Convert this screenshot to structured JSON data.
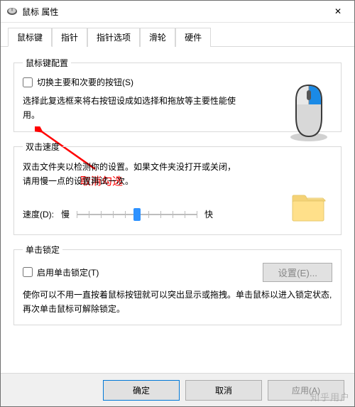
{
  "window": {
    "title": "鼠标 属性"
  },
  "tabs": {
    "items": [
      {
        "label": "鼠标键"
      },
      {
        "label": "指针"
      },
      {
        "label": "指针选项"
      },
      {
        "label": "滑轮"
      },
      {
        "label": "硬件"
      }
    ],
    "active_index": 0
  },
  "group_buttons": {
    "legend": "鼠标键配置",
    "checkbox_label": "切换主要和次要的按钮(S)",
    "checked": false,
    "description": "选择此复选框来将右按钮设成如选择和拖放等主要性能使用。"
  },
  "group_doubleclick": {
    "legend": "双击速度",
    "description": "双击文件夹以检测你的设置。如果文件夹没打开或关闭，请用慢一点的设置再试一次。",
    "speed_label": "速度(D):",
    "slow_label": "慢",
    "fast_label": "快",
    "slider_value": 5,
    "slider_max": 10
  },
  "group_clicklock": {
    "legend": "单击锁定",
    "checkbox_label": "启用单击锁定(T)",
    "checked": false,
    "settings_button": "设置(E)...",
    "description": "使你可以不用一直按着鼠标按钮就可以突出显示或拖拽。单击鼠标以进入锁定状态,再次单击鼠标可解除锁定。"
  },
  "footer": {
    "ok": "确定",
    "cancel": "取消",
    "apply": "应用(A)"
  },
  "annotation": {
    "text": "取消勾选"
  },
  "watermark": "知乎用户",
  "icons": {
    "close": "✕"
  }
}
